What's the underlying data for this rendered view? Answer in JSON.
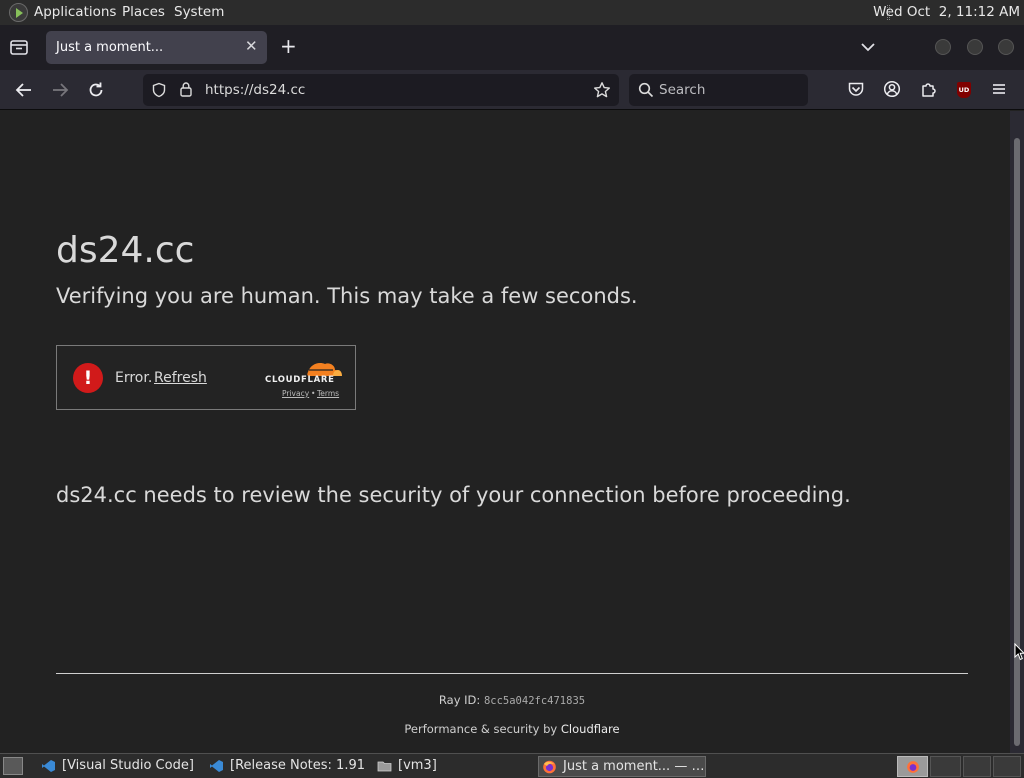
{
  "top_panel": {
    "menus": [
      "Applications",
      "Places",
      "System"
    ],
    "clock": "Wed Oct  2, 11:12 AM"
  },
  "browser": {
    "tab": {
      "title": "Just a moment...",
      "close_glyph": "✕"
    },
    "new_tab_glyph": "+",
    "url": "https://ds24.cc",
    "search_placeholder": "Search",
    "ublock_badge": "UD"
  },
  "page": {
    "site_title": "ds24.cc",
    "verifying_text": "Verifying you are human. This may take a few seconds.",
    "widget": {
      "error_glyph": "!",
      "error_label": "Error.",
      "refresh_label": "Refresh",
      "cloudflare_word": "CLOUDFLARE",
      "privacy": "Privacy",
      "separator": "•",
      "terms": "Terms"
    },
    "review_text": "ds24.cc needs to review the security of your connection before proceeding.",
    "footer": {
      "ray_label": "Ray ID:",
      "ray_value": "8cc5a042fc471835",
      "perf_label": "Performance & security by",
      "perf_brand": "Cloudflare"
    }
  },
  "taskbar": {
    "tasks": [
      {
        "label": "[Visual Studio Code]",
        "icon": "vscode-icon"
      },
      {
        "label": "[Release Notes: 1.91…",
        "icon": "vscode-icon"
      },
      {
        "label": "[vm3]",
        "icon": "folder-icon"
      },
      {
        "label": "Just a moment... — …",
        "icon": "firefox-icon"
      }
    ]
  },
  "colors": {
    "page_bg": "#222222",
    "error_red": "#d11a1a",
    "cloudflare_orange": "#f38020"
  }
}
